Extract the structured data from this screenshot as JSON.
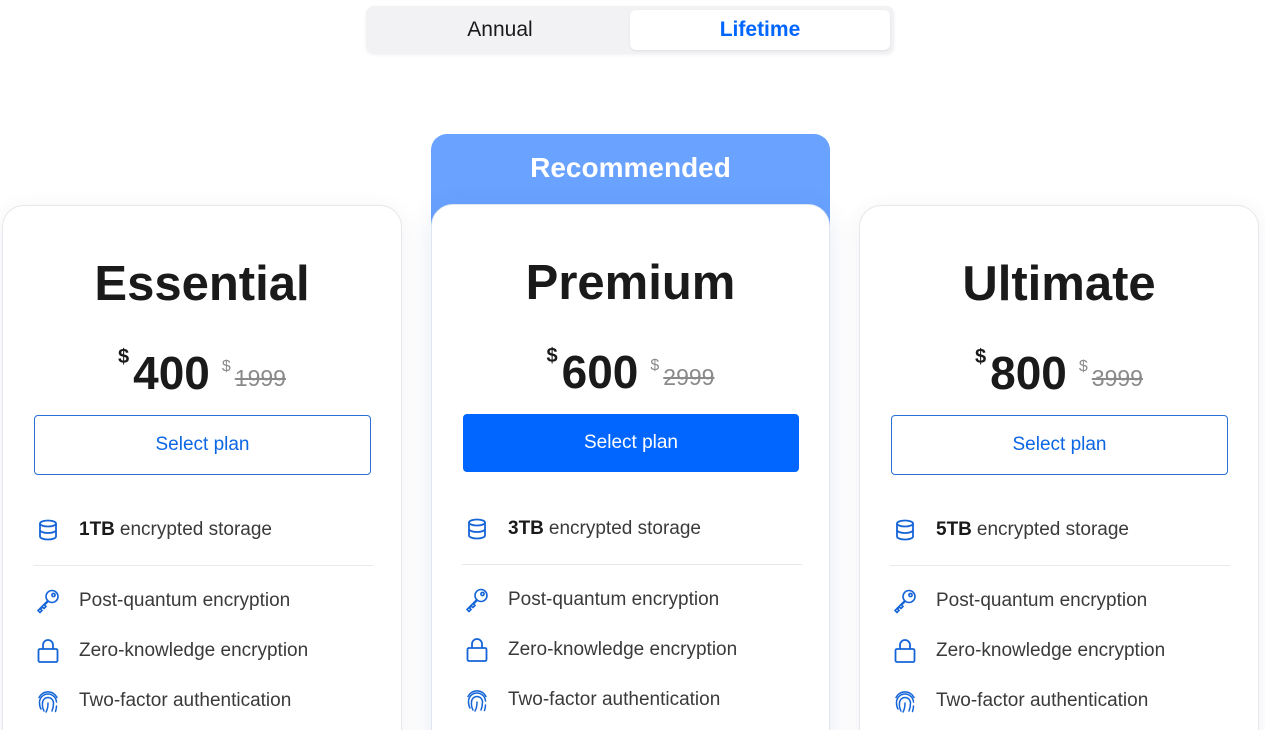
{
  "billing_toggle": {
    "options": [
      "Annual",
      "Lifetime"
    ],
    "selected": "Lifetime"
  },
  "recommended_label": "Recommended",
  "colors": {
    "accent": "#0066ff",
    "recommended_bg": "#69a2ff",
    "text": "#1a1a1a",
    "muted": "#8a8a8a"
  },
  "plans": [
    {
      "name": "Essential",
      "currency": "$",
      "price": "400",
      "old_currency": "$",
      "old_price": "1999",
      "button": "Select plan",
      "storage_amount": "1TB",
      "storage_text": "encrypted storage",
      "features": [
        "Post-quantum encryption",
        "Zero-knowledge encryption",
        "Two-factor authentication"
      ]
    },
    {
      "name": "Premium",
      "currency": "$",
      "price": "600",
      "old_currency": "$",
      "old_price": "2999",
      "button": "Select plan",
      "storage_amount": "3TB",
      "storage_text": "encrypted storage",
      "features": [
        "Post-quantum encryption",
        "Zero-knowledge encryption",
        "Two-factor authentication"
      ]
    },
    {
      "name": "Ultimate",
      "currency": "$",
      "price": "800",
      "old_currency": "$",
      "old_price": "3999",
      "button": "Select plan",
      "storage_amount": "5TB",
      "storage_text": "encrypted storage",
      "features": [
        "Post-quantum encryption",
        "Zero-knowledge encryption",
        "Two-factor authentication"
      ]
    }
  ],
  "feature_icons": [
    "database-icon",
    "key-icon",
    "lock-icon",
    "fingerprint-icon"
  ]
}
